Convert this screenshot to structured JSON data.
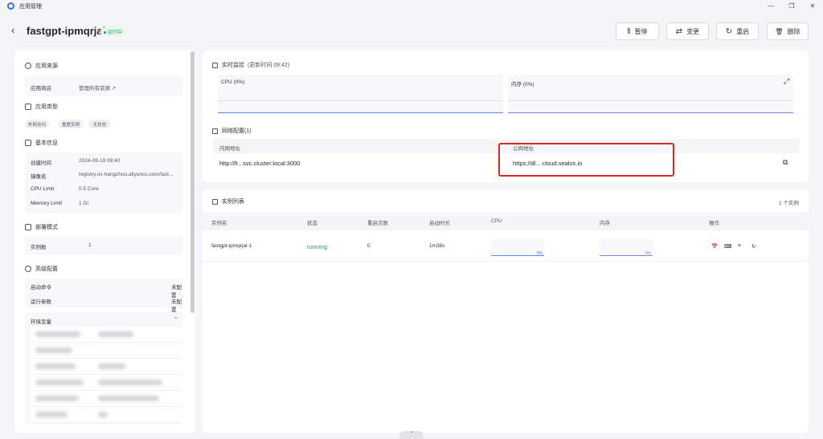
{
  "window": {
    "title": "应用管理",
    "controls": [
      "—",
      "❐",
      "✕"
    ]
  },
  "header": {
    "back": "‹",
    "app_name": "fastgpt-ipmqrjal",
    "status": "运行中",
    "buttons": {
      "pause": "暂停",
      "change": "变更",
      "restart": "重启",
      "delete": "删除"
    },
    "icons": {
      "pause": "‖",
      "change": "⇄",
      "restart": "↻",
      "delete": "🗑"
    }
  },
  "left": {
    "source": {
      "title": "应用来源",
      "key": "应用商店",
      "value": "管理所有资源 ↗"
    },
    "type": {
      "title": "应用类型",
      "tags": [
        "外网访问",
        "重度实例",
        "无状态"
      ]
    },
    "basic": {
      "title": "基本信息",
      "rows": [
        {
          "k": "创建时间",
          "v": "2024-09-19 09:40"
        },
        {
          "k": "镜像名",
          "v": "registry.cn-hangzhou.aliyuncs.com/fast..."
        },
        {
          "k": "CPU Limit",
          "v": "0.5 Core"
        },
        {
          "k": "Memory Limit",
          "v": "1 Gi"
        }
      ]
    },
    "deploy": {
      "title": "部署模式",
      "key": "实例数",
      "value": "1"
    },
    "advanced": {
      "title": "高级配置",
      "cmd": {
        "k": "启动命令",
        "v": "未配置"
      },
      "args": {
        "k": "运行参数",
        "v": "未配置"
      },
      "env_title": "环境变量",
      "env_toggle": "⌃"
    }
  },
  "monitor": {
    "title": "实时监控",
    "updated": "(更新时间 09:42)",
    "cpu": "CPU (0%)",
    "mem": "内存 (0%)",
    "expand": "⤢",
    "cpu_color": "#5b8def",
    "mem_color": "#8f7bd8"
  },
  "network": {
    "title": "网络配置(1)",
    "inner_label": "内网地址",
    "public_label": "公网地址",
    "inner_value": "http://fr...svc.cluster.local:3000",
    "public_value": "https://dl... cloud.sealos.io",
    "copy": "⧉"
  },
  "instances": {
    "title": "实例列表",
    "count": "1 个实例",
    "columns": [
      "实例名",
      "状态",
      "重启次数",
      "启动时长",
      "CPU",
      "内存",
      "操作"
    ],
    "rows": [
      {
        "name": "fastgpt-ipmqrjal-1",
        "status": "running",
        "restarts": "0",
        "uptime": "1m38s",
        "cpu": "0%",
        "mem": "0%"
      }
    ],
    "op_icons": [
      "📅",
      "⌨",
      "≡",
      "↻"
    ]
  },
  "bottom": {
    "handle": "⌃"
  }
}
